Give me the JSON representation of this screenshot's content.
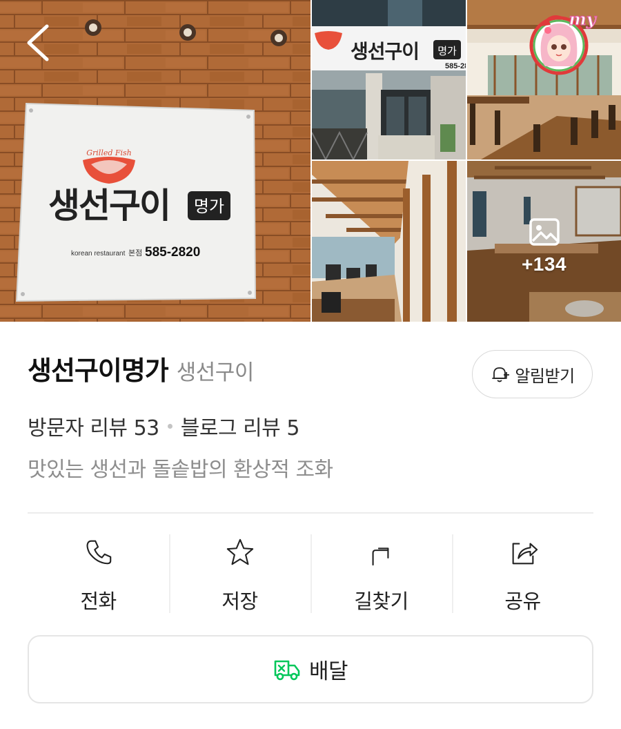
{
  "gallery": {
    "sign_text": "생선구이",
    "sign_badge": "명가",
    "sign_logo_text": "Grilled Fish",
    "sign_subtitle": "korean restaurant",
    "sign_branch": "본점",
    "sign_phone": "585-2820",
    "storefront_sign_text": "생선구이",
    "storefront_sign_badge": "명가",
    "storefront_phone": "585-28",
    "more_count": "+134",
    "avatar_badge": "my"
  },
  "place": {
    "name": "생선구이명가",
    "category": "생선구이",
    "notify_label": "알림받기",
    "visitor_reviews": "방문자 리뷰 53",
    "blog_reviews": "블로그 리뷰 5",
    "tagline": "맛있는 생선과 돌솥밥의 환상적 조화"
  },
  "actions": [
    {
      "label": "전화",
      "icon": "phone-icon"
    },
    {
      "label": "저장",
      "icon": "star-icon"
    },
    {
      "label": "길찾기",
      "icon": "directions-icon"
    },
    {
      "label": "공유",
      "icon": "share-icon"
    }
  ],
  "delivery": {
    "label": "배달",
    "icon": "delivery-truck-icon",
    "icon_color": "#03c75a"
  },
  "colors": {
    "accent_green": "#03c75a",
    "sign_red": "#e8503a",
    "wood": "#b9713d"
  }
}
